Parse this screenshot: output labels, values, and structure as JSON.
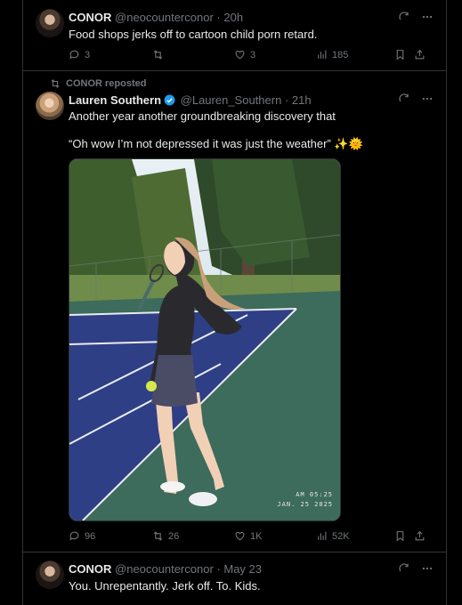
{
  "tweets": [
    {
      "name": "CONOR",
      "handle": "@neocounterconor",
      "time": "· 20h",
      "text": "Food shops jerks off to cartoon child porn retard.",
      "replies": "3",
      "reposts": "",
      "likes": "3",
      "views": "185"
    },
    {
      "repost_label": "CONOR reposted",
      "name": "Lauren Southern",
      "handle": "@Lauren_Southern",
      "time": "· 21h",
      "text_line1": "Another year another groundbreaking discovery that",
      "text_line2": "“Oh wow I’m not depressed it was just the weather” ✨🌞",
      "image_stamp_time": "AM 05:25",
      "image_stamp_date": "JAN. 25  2025",
      "replies": "96",
      "reposts": "26",
      "likes": "1K",
      "views": "52K"
    },
    {
      "name": "CONOR",
      "handle": "@neocounterconor",
      "time": "· May 23",
      "text": "You. Unrepentantly. Jerk off. To. Kids."
    }
  ],
  "colors": {
    "background": "#000000",
    "text": "#e7e9ea",
    "muted": "#71767b",
    "border": "#2f3336",
    "verified": "#1d9bf0"
  }
}
